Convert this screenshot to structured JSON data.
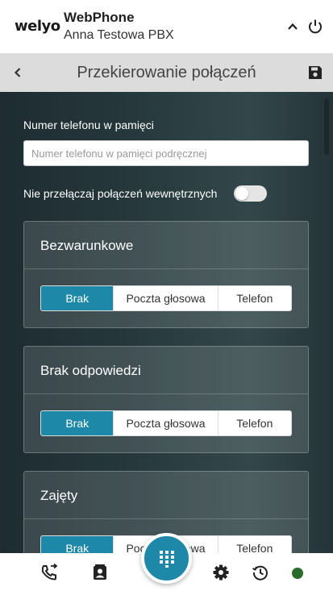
{
  "header": {
    "logo": "welyo",
    "title": "WebPhone",
    "subtitle": "Anna Testowa PBX",
    "icons": [
      "chevron-up-icon",
      "power-icon"
    ]
  },
  "titlebar": {
    "title": "Przekierowanie połączeń",
    "icons": [
      "chevron-left-icon",
      "save-icon"
    ]
  },
  "form": {
    "phone_label": "Numer telefonu w pamięci",
    "phone_value": "",
    "phone_placeholder": "Numer telefonu w pamięci podręcznej",
    "toggle_label": "Nie przełączaj połączeń wewnętrznych",
    "toggle_on": false
  },
  "cards": [
    {
      "title": "Bezwarunkowe",
      "options": [
        "Brak",
        "Poczta głosowa",
        "Telefon"
      ],
      "selected": "Brak"
    },
    {
      "title": "Brak odpowiedzi",
      "options": [
        "Brak",
        "Poczta głosowa",
        "Telefon"
      ],
      "selected": "Brak"
    },
    {
      "title": "Zajęty",
      "options": [
        "Brak",
        "Poczta głosowa",
        "Telefon"
      ],
      "selected": "Brak"
    }
  ],
  "bottom_nav": {
    "items": [
      "phone-forward-icon",
      "contacts-icon",
      "dialpad-icon",
      "gear-icon",
      "history-icon"
    ],
    "status": "online"
  },
  "colors": {
    "accent": "#1e88a8",
    "status_online": "#2a6a2a",
    "header_bg": "#ffffff",
    "titlebar_bg": "#dcdcdc"
  }
}
